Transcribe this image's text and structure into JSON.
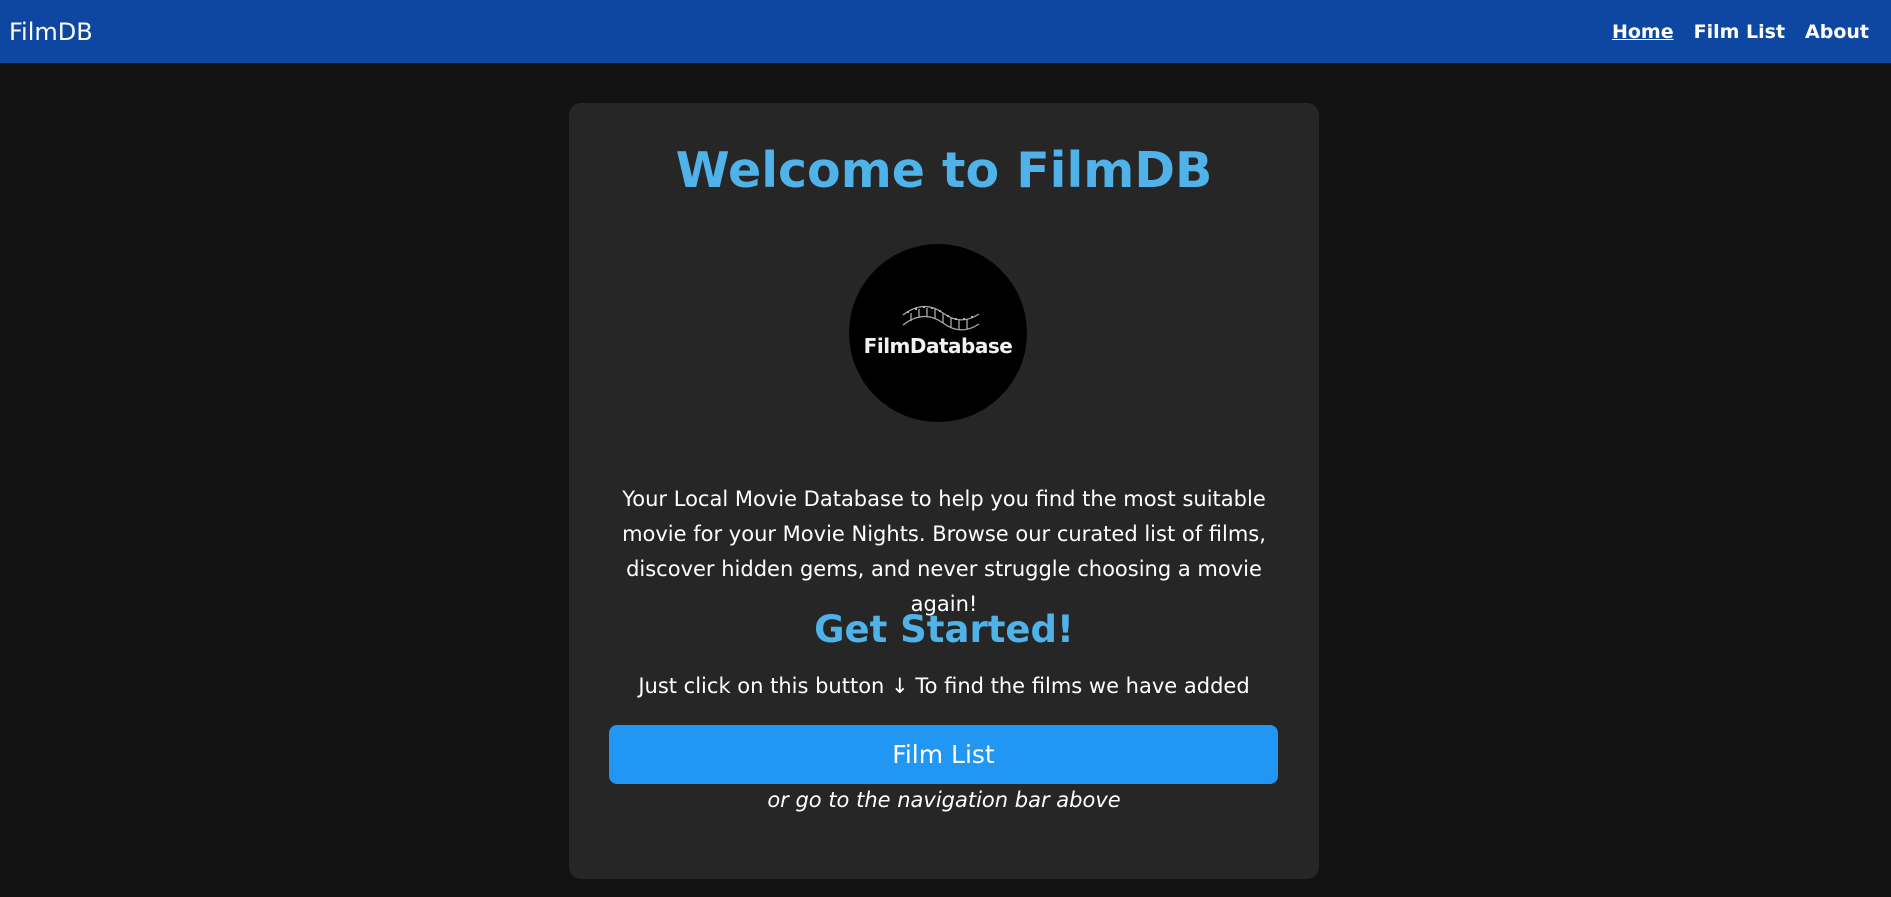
{
  "nav": {
    "brand": "FilmDB",
    "links": [
      {
        "label": "Home",
        "active": true
      },
      {
        "label": "Film List",
        "active": false
      },
      {
        "label": "About",
        "active": false
      }
    ]
  },
  "hero": {
    "title": "Welcome to FilmDB",
    "logo_text": "FilmDatabase",
    "logo_icon": "film-strip-icon",
    "description": "Your Local Movie Database to help you find the most suitable movie for your Movie Nights. Browse our curated list of films, discover hidden gems, and never struggle choosing a movie again!",
    "subtitle": "Get Started!",
    "instruction": "Just click on this button ↓ To find the films we have added",
    "button_label": "Film List",
    "alt_note": "or go to the navigation bar above"
  },
  "colors": {
    "navbar": "#0d47a1",
    "background": "#121212",
    "card": "#262626",
    "accent": "#4fb3ea",
    "button": "#2196f3"
  }
}
